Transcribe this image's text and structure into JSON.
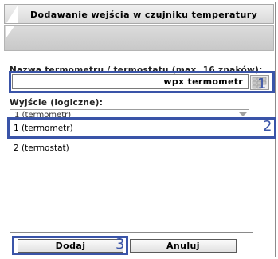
{
  "window": {
    "title": "Dodawanie wejścia w czujniku temperatury"
  },
  "form": {
    "name_label": "Nazwa termometru / termostatu (max. 16 znaków):",
    "name_value": "wpx termometr",
    "output_label": "Wyjście (logiczne):",
    "select_value": "1 (termometr)",
    "options": [
      "1 (termometr)",
      "2 (termostat)"
    ]
  },
  "buttons": {
    "add": "Dodaj",
    "cancel": "Anuluj"
  },
  "callouts": [
    "1",
    "2",
    "3"
  ],
  "icons": {
    "picker": "grid-picker-icon"
  },
  "colors": {
    "callout": "#3a54a8"
  }
}
